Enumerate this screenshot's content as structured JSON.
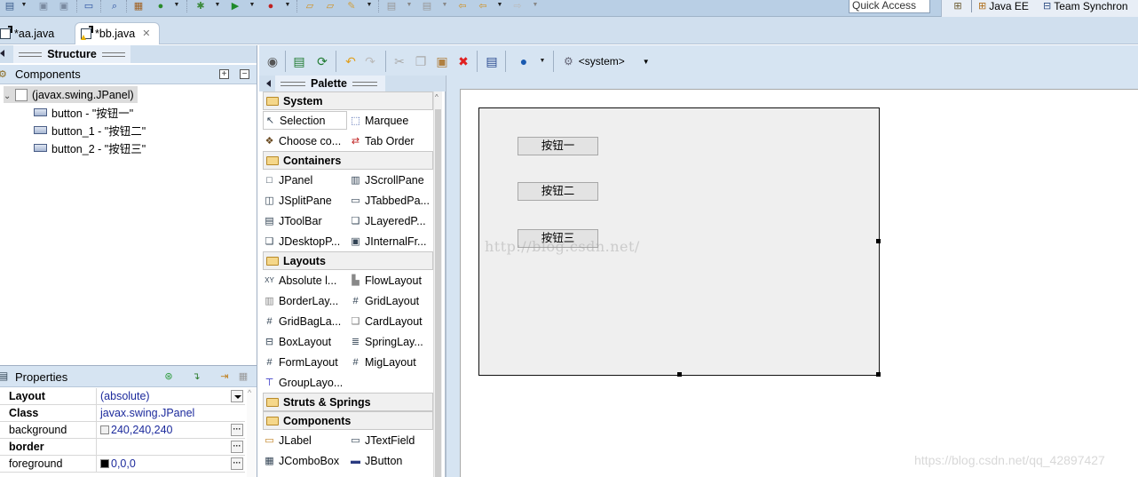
{
  "toolbar": {
    "icons": [
      "new-wizard-icon",
      "save-icon",
      "save-all-icon",
      "print-icon",
      "search-icon",
      "package-icon",
      "refresh-icon",
      "debug-icon",
      "run-icon",
      "external-tools-icon",
      "open-type-icon",
      "open-resource-icon",
      "brush-icon",
      "next-annotation-icon",
      "prev-annotation-icon",
      "back-icon",
      "forward-icon"
    ],
    "quick_access_placeholder": "Quick Access"
  },
  "perspectives": [
    {
      "label": "Java EE",
      "icon": "java-ee-icon"
    },
    {
      "label": "Team Synchron",
      "icon": "team-sync-icon"
    }
  ],
  "editor_tabs": [
    {
      "label": "*aa.java",
      "active": false
    },
    {
      "label": "*bb.java",
      "active": true
    }
  ],
  "structure": {
    "tab_label": "Structure",
    "components_label": "Components",
    "tree": [
      {
        "label": "(javax.swing.JPanel)",
        "level": 0,
        "icon": "jpanel-icon",
        "selected": true
      },
      {
        "label": "button - \"按钮一\"",
        "level": 1,
        "icon": "jbutton-icon"
      },
      {
        "label": "button_1 - \"按钮二\"",
        "level": 1,
        "icon": "jbutton-bound-icon"
      },
      {
        "label": "button_2 - \"按钮三\"",
        "level": 1,
        "icon": "jbutton-icon"
      }
    ]
  },
  "properties": {
    "title": "Properties",
    "rows": [
      {
        "name": "Layout",
        "value": "(absolute)",
        "bold": true,
        "editor": "dropdown"
      },
      {
        "name": "Class",
        "value": "javax.swing.JPanel",
        "bold": true,
        "editor": "none"
      },
      {
        "name": "background",
        "value": "240,240,240",
        "bold": false,
        "editor": "ellipsis",
        "swatch": "#f0f0f0"
      },
      {
        "name": "border",
        "value": "",
        "bold": true,
        "editor": "ellipsis"
      },
      {
        "name": "foreground",
        "value": "0,0,0",
        "bold": false,
        "editor": "ellipsis",
        "swatch": "#000000"
      }
    ]
  },
  "designer_toolbar": {
    "system_combo": "<system>"
  },
  "palette": {
    "title": "Palette",
    "categories": [
      {
        "label": "System",
        "items": [
          {
            "label": "Selection",
            "icon": "arrow-pointer-icon",
            "selected": true
          },
          {
            "label": "Marquee",
            "icon": "marquee-icon"
          },
          {
            "label": "Choose co...",
            "icon": "choose-component-icon"
          },
          {
            "label": "Tab Order",
            "icon": "tab-order-icon"
          }
        ]
      },
      {
        "label": "Containers",
        "items": [
          {
            "label": "JPanel",
            "icon": "jpanel-icon"
          },
          {
            "label": "JScrollPane",
            "icon": "jscrollpane-icon"
          },
          {
            "label": "JSplitPane",
            "icon": "jsplitpane-icon"
          },
          {
            "label": "JTabbedPa...",
            "icon": "jtabbedpane-icon"
          },
          {
            "label": "JToolBar",
            "icon": "jtoolbar-icon"
          },
          {
            "label": "JLayeredP...",
            "icon": "jlayeredpane-icon"
          },
          {
            "label": "JDesktopP...",
            "icon": "jdesktoppane-icon"
          },
          {
            "label": "JInternalFr...",
            "icon": "jinternalframe-icon"
          }
        ]
      },
      {
        "label": "Layouts",
        "items": [
          {
            "label": "Absolute l...",
            "icon": "absolute-layout-icon"
          },
          {
            "label": "FlowLayout",
            "icon": "flow-layout-icon"
          },
          {
            "label": "BorderLay...",
            "icon": "border-layout-icon"
          },
          {
            "label": "GridLayout",
            "icon": "grid-layout-icon"
          },
          {
            "label": "GridBagLa...",
            "icon": "gridbag-layout-icon"
          },
          {
            "label": "CardLayout",
            "icon": "card-layout-icon"
          },
          {
            "label": "BoxLayout",
            "icon": "box-layout-icon"
          },
          {
            "label": "SpringLay...",
            "icon": "spring-layout-icon"
          },
          {
            "label": "FormLayout",
            "icon": "form-layout-icon"
          },
          {
            "label": "MigLayout",
            "icon": "mig-layout-icon"
          },
          {
            "label": "GroupLayo...",
            "icon": "group-layout-icon"
          }
        ]
      },
      {
        "label": "Struts & Springs",
        "items": [],
        "collapsed": true
      },
      {
        "label": "Components",
        "items": [
          {
            "label": "JLabel",
            "icon": "jlabel-icon"
          },
          {
            "label": "JTextField",
            "icon": "jtextfield-icon"
          },
          {
            "label": "JComboBox",
            "icon": "jcombobox-icon"
          },
          {
            "label": "JButton",
            "icon": "jbutton-icon"
          }
        ]
      }
    ]
  },
  "design": {
    "buttons": [
      "按钮一",
      "按钮二",
      "按钮三"
    ],
    "watermark_center": "http://blog.csdn.net/",
    "watermark_corner": "https://blog.csdn.net/qq_42897427"
  }
}
